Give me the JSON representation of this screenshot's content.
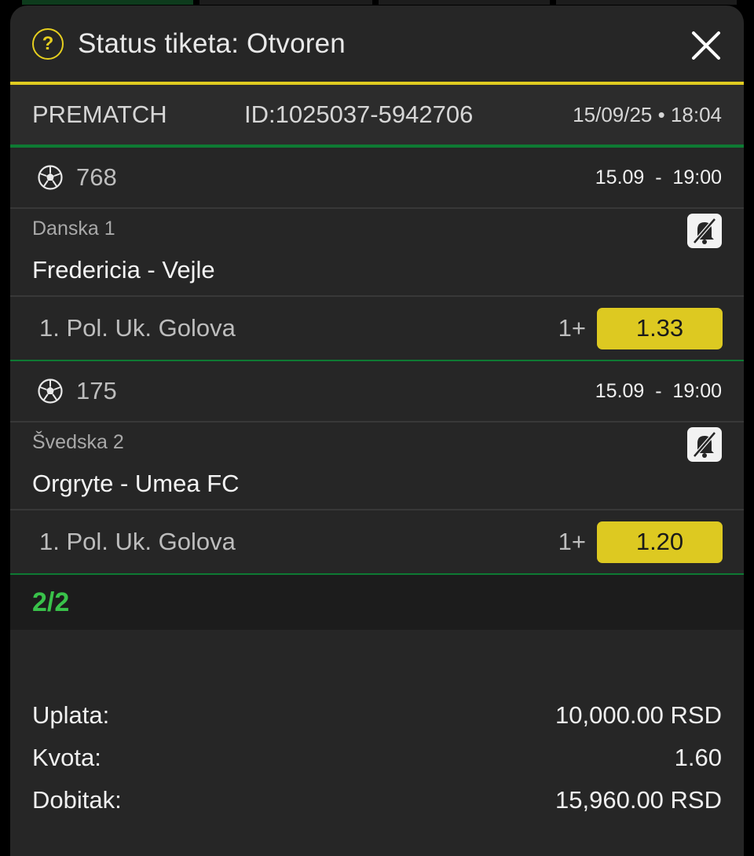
{
  "modal": {
    "title": "Status tiketa: Otvoren",
    "help_icon": "question-circle-icon",
    "close_icon": "close-icon"
  },
  "ticket": {
    "type": "PREMATCH",
    "id": "ID:1025037-5942706",
    "datetime": "15/09/25 • 18:04"
  },
  "matches": [
    {
      "code": "768",
      "time": "15.09  -  19:00",
      "league": "Danska 1",
      "teams": "Fredericia - Vejle",
      "market": "1. Pol. Uk. Golova",
      "pick": "1+",
      "odd": "1.33"
    },
    {
      "code": "175",
      "time": "15.09  -  19:00",
      "league": "Švedska 2",
      "teams": "Orgryte - Umea FC",
      "market": "1. Pol. Uk. Golova",
      "pick": "1+",
      "odd": "1.20"
    }
  ],
  "summary": {
    "count": "2/2",
    "stake_label": "Uplata:",
    "stake_value": "10,000.00 RSD",
    "odds_label": "Kvota:",
    "odds_value": "1.60",
    "win_label": "Dobitak:",
    "win_value": "15,960.00 RSD"
  },
  "colors": {
    "accent_yellow": "#ddc921",
    "accent_green": "#0e7a33",
    "count_green": "#39c24a",
    "background": "#262626"
  }
}
